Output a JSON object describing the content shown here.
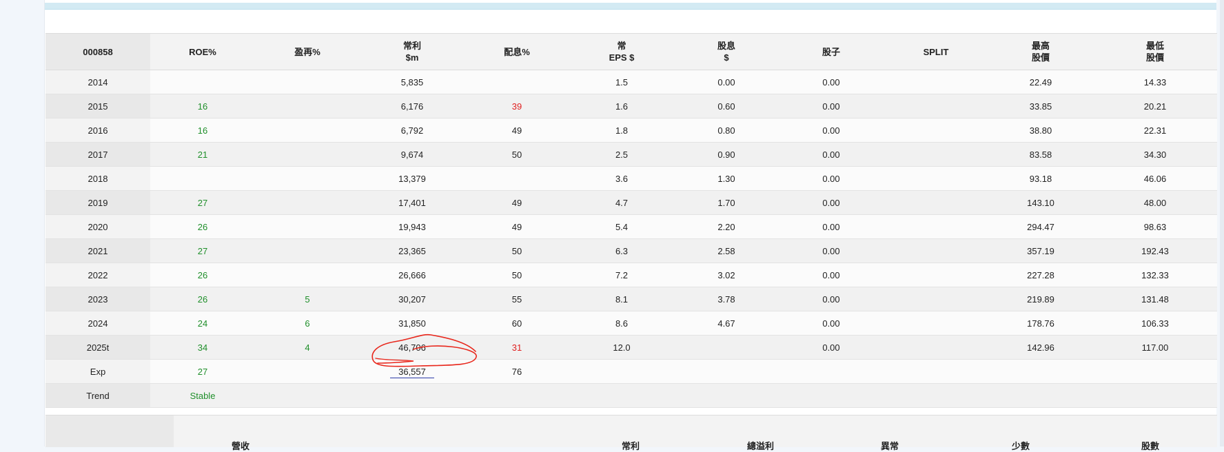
{
  "table": {
    "headers": [
      {
        "line1": "000858",
        "line2": ""
      },
      {
        "line1": "ROE%",
        "line2": ""
      },
      {
        "line1": "盈再%",
        "line2": ""
      },
      {
        "line1": "常利",
        "line2": "$m"
      },
      {
        "line1": "配息%",
        "line2": ""
      },
      {
        "line1": "常",
        "line2": "EPS $"
      },
      {
        "line1": "股息",
        "line2": "$"
      },
      {
        "line1": "股子",
        "line2": ""
      },
      {
        "line1": "SPLIT",
        "line2": ""
      },
      {
        "line1": "最高",
        "line2": "股價"
      },
      {
        "line1": "最低",
        "line2": "股價"
      }
    ],
    "rows": [
      [
        "2014",
        "",
        "",
        "5,835",
        "",
        "1.5",
        "0.00",
        "0.00",
        "",
        "22.49",
        "14.33"
      ],
      [
        "2015",
        "16",
        "",
        "6,176",
        "39",
        "1.6",
        "0.60",
        "0.00",
        "",
        "33.85",
        "20.21"
      ],
      [
        "2016",
        "16",
        "",
        "6,792",
        "49",
        "1.8",
        "0.80",
        "0.00",
        "",
        "38.80",
        "22.31"
      ],
      [
        "2017",
        "21",
        "",
        "9,674",
        "50",
        "2.5",
        "0.90",
        "0.00",
        "",
        "83.58",
        "34.30"
      ],
      [
        "2018",
        "",
        "",
        "13,379",
        "",
        "3.6",
        "1.30",
        "0.00",
        "",
        "93.18",
        "46.06"
      ],
      [
        "2019",
        "27",
        "",
        "17,401",
        "49",
        "4.7",
        "1.70",
        "0.00",
        "",
        "143.10",
        "48.00"
      ],
      [
        "2020",
        "26",
        "",
        "19,943",
        "49",
        "5.4",
        "2.20",
        "0.00",
        "",
        "294.47",
        "98.63"
      ],
      [
        "2021",
        "27",
        "",
        "23,365",
        "50",
        "6.3",
        "2.58",
        "0.00",
        "",
        "357.19",
        "192.43"
      ],
      [
        "2022",
        "26",
        "",
        "26,666",
        "50",
        "7.2",
        "3.02",
        "0.00",
        "",
        "227.28",
        "132.33"
      ],
      [
        "2023",
        "26",
        "5",
        "30,207",
        "55",
        "8.1",
        "3.78",
        "0.00",
        "",
        "219.89",
        "131.48"
      ],
      [
        "2024",
        "24",
        "6",
        "31,850",
        "60",
        "8.6",
        "4.67",
        "0.00",
        "",
        "178.76",
        "106.33"
      ],
      [
        "2025t",
        "34",
        "4",
        "46,706",
        "31",
        "12.0",
        "",
        "0.00",
        "",
        "142.96",
        "117.00"
      ],
      [
        "Exp",
        "27",
        "",
        "36,557",
        "76",
        "",
        "",
        "",
        "",
        "",
        ""
      ],
      [
        "Trend",
        "Stable",
        "",
        "",
        "",
        "",
        "",
        "",
        "",
        "",
        ""
      ]
    ],
    "colors": {
      "positive": "#1f8f2a",
      "negative": "#e02020",
      "underline": "#2b3aa8",
      "annotation": "#e8261b"
    },
    "green_cells": [
      [
        1,
        1
      ],
      [
        2,
        1
      ],
      [
        3,
        1
      ],
      [
        5,
        1
      ],
      [
        6,
        1
      ],
      [
        7,
        1
      ],
      [
        8,
        1
      ],
      [
        9,
        1
      ],
      [
        10,
        1
      ],
      [
        11,
        1
      ],
      [
        12,
        1
      ],
      [
        13,
        1
      ],
      [
        9,
        2
      ],
      [
        10,
        2
      ],
      [
        11,
        2
      ]
    ],
    "red_cells": [
      [
        1,
        4
      ],
      [
        11,
        4
      ]
    ],
    "underlined_cells": [
      [
        12,
        3
      ]
    ],
    "circled_cells": [
      [
        11,
        3
      ]
    ]
  },
  "lower_table": {
    "headers": [
      "營收",
      "常利",
      "總溢利",
      "異常",
      "少數",
      "股數"
    ]
  }
}
